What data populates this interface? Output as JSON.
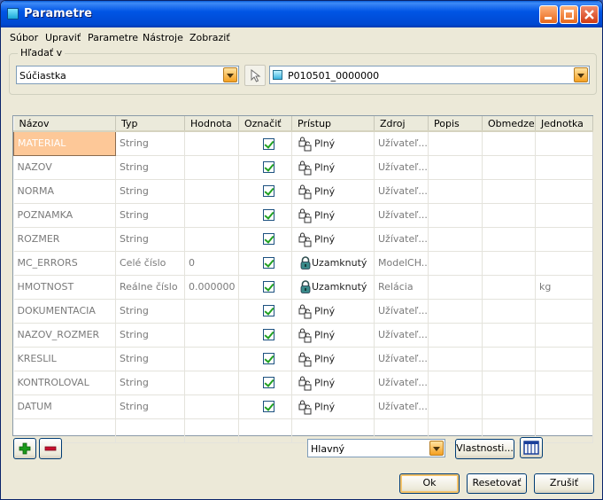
{
  "window": {
    "title": "Parametre"
  },
  "menu": [
    "Súbor",
    "Upraviť",
    "Parametre",
    "Nástroje",
    "Zobraziť"
  ],
  "search": {
    "label": "Hľadať v",
    "scope_value": "Súčiastka",
    "object_value": "P010501_0000000"
  },
  "table": {
    "columns": [
      "Názov",
      "Typ",
      "Hodnota",
      "Označiť",
      "Prístup",
      "Zdroj",
      "Popis",
      "Obmedze...",
      "Jednotka"
    ],
    "rows": [
      {
        "name": "MATERIAL",
        "type": "String",
        "value": "",
        "checked": true,
        "access": "Plný",
        "access_icon": "full-access-icon",
        "source": "Užívateľ...",
        "desc": "",
        "limit": "",
        "unit": ""
      },
      {
        "name": "NAZOV",
        "type": "String",
        "value": "",
        "checked": true,
        "access": "Plný",
        "access_icon": "full-access-icon",
        "source": "Užívateľ...",
        "desc": "",
        "limit": "",
        "unit": ""
      },
      {
        "name": "NORMA",
        "type": "String",
        "value": "",
        "checked": true,
        "access": "Plný",
        "access_icon": "full-access-icon",
        "source": "Užívateľ...",
        "desc": "",
        "limit": "",
        "unit": ""
      },
      {
        "name": "POZNAMKA",
        "type": "String",
        "value": "",
        "checked": true,
        "access": "Plný",
        "access_icon": "full-access-icon",
        "source": "Užívateľ...",
        "desc": "",
        "limit": "",
        "unit": ""
      },
      {
        "name": "ROZMER",
        "type": "String",
        "value": "",
        "checked": true,
        "access": "Plný",
        "access_icon": "full-access-icon",
        "source": "Užívateľ...",
        "desc": "",
        "limit": "",
        "unit": ""
      },
      {
        "name": "MC_ERRORS",
        "type": "Celé číslo",
        "value": "0",
        "checked": true,
        "access": "Uzamknutý",
        "access_icon": "locked-icon",
        "source": "ModelCH...",
        "desc": "",
        "limit": "",
        "unit": ""
      },
      {
        "name": "HMOTNOST",
        "type": "Reálne číslo",
        "value": "0.000000",
        "checked": true,
        "access": "Uzamknutý",
        "access_icon": "locked-icon",
        "source": "Relácia",
        "desc": "",
        "limit": "",
        "unit": "kg"
      },
      {
        "name": "DOKUMENTACIA",
        "type": "String",
        "value": "",
        "checked": true,
        "access": "Plný",
        "access_icon": "full-access-icon",
        "source": "Užívateľ...",
        "desc": "",
        "limit": "",
        "unit": ""
      },
      {
        "name": "NAZOV_ROZMER",
        "type": "String",
        "value": "",
        "checked": true,
        "access": "Plný",
        "access_icon": "full-access-icon",
        "source": "Užívateľ...",
        "desc": "",
        "limit": "",
        "unit": ""
      },
      {
        "name": "KRESLIL",
        "type": "String",
        "value": "",
        "checked": true,
        "access": "Plný",
        "access_icon": "full-access-icon",
        "source": "Užívateľ...",
        "desc": "",
        "limit": "",
        "unit": ""
      },
      {
        "name": "KONTROLOVAL",
        "type": "String",
        "value": "",
        "checked": true,
        "access": "Plný",
        "access_icon": "full-access-icon",
        "source": "Užívateľ...",
        "desc": "",
        "limit": "",
        "unit": ""
      },
      {
        "name": "DATUM",
        "type": "String",
        "value": "",
        "checked": true,
        "access": "Plný",
        "access_icon": "full-access-icon",
        "source": "Užívateľ...",
        "desc": "",
        "limit": "",
        "unit": ""
      }
    ]
  },
  "bottom": {
    "filter_value": "Hlavný",
    "properties_label": "Vlastnosti...",
    "ok_label": "Ok",
    "reset_label": "Resetovať",
    "cancel_label": "Zrušiť"
  },
  "colors": {
    "accent": "#0055e5",
    "selection": "#fdc898",
    "add_green": "#1a9a1a",
    "remove_red": "#c8102e"
  }
}
